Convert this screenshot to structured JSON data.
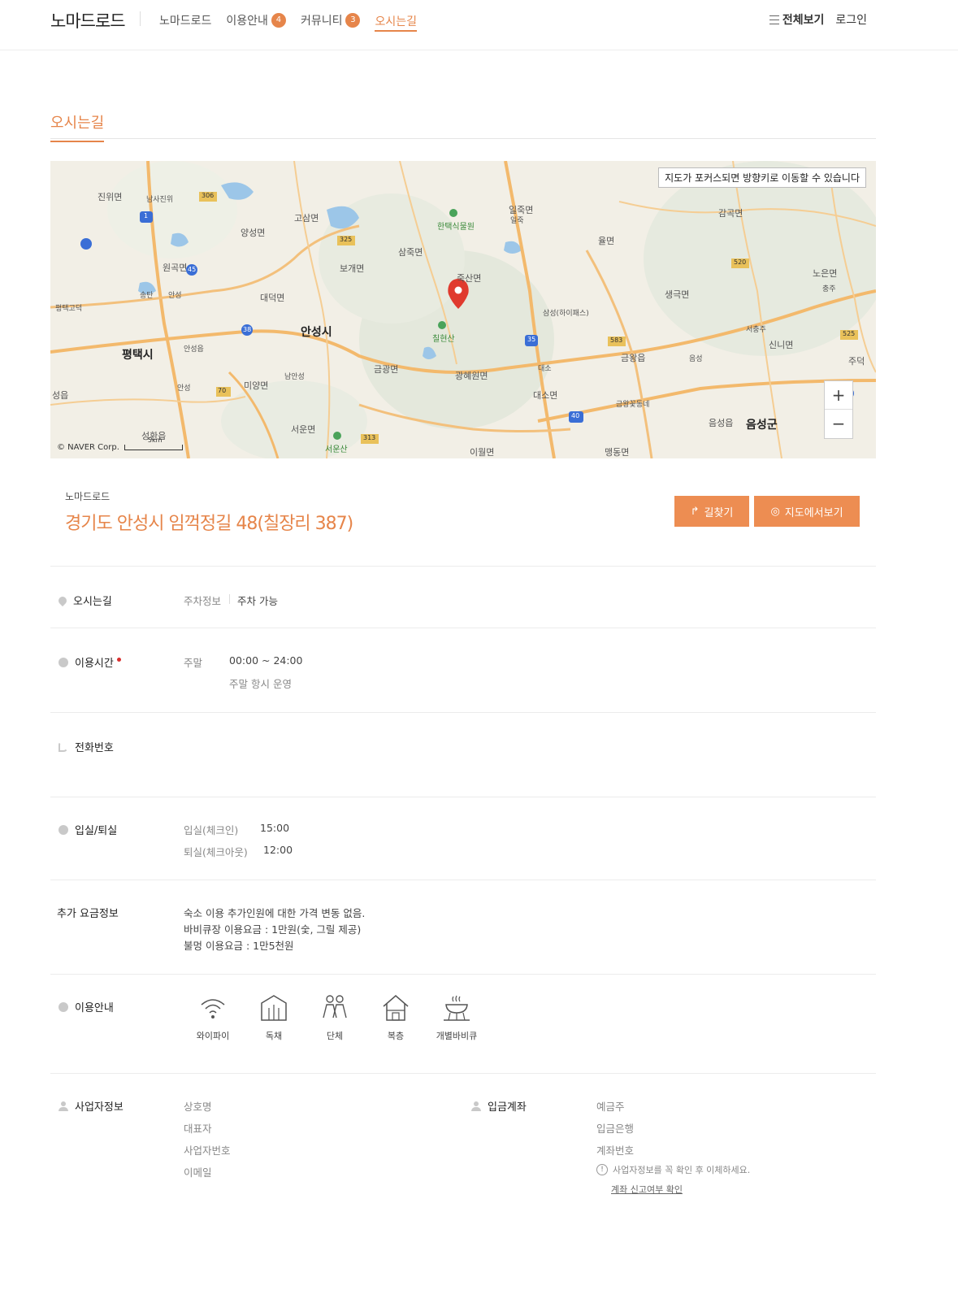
{
  "header": {
    "logo": "노마드로드",
    "nav": [
      {
        "label": "노마드로드",
        "badge": ""
      },
      {
        "label": "이용안내",
        "badge": "4"
      },
      {
        "label": "커뮤니티",
        "badge": "3"
      },
      {
        "label": "오시는길",
        "badge": ""
      }
    ],
    "all_menu": "전체보기",
    "login": "로그인"
  },
  "section_title": "오시는길",
  "map": {
    "tip": "지도가 포커스되면 방향키로 이동할 수 있습니다",
    "zoom_in": "+",
    "zoom_out": "−",
    "copyright": "© NAVER Corp.",
    "scale": "5km",
    "places": {
      "p1": "진위면",
      "p2": "남사진위",
      "p3": "고삼면",
      "p4": "양성면",
      "p5": "원곡면",
      "p6": "대덕면",
      "p7": "안성시",
      "p8": "평택시",
      "p9": "안성",
      "p10": "미양면",
      "p11": "서운면",
      "p12": "서운산",
      "p13": "성환읍",
      "p14": "보개면",
      "p15": "삼죽면",
      "p16": "죽산면",
      "p17": "칠현산",
      "p18": "금광면",
      "p19": "광혜원면",
      "p20": "이월면",
      "p21": "한택식물원",
      "p22": "일죽면",
      "p23": "율면",
      "p24": "생극면",
      "p25": "감곡면",
      "p26": "노은면",
      "p27": "신니면",
      "p28": "금왕읍",
      "p29": "대소면",
      "p30": "음성군",
      "p31": "음성읍",
      "p32": "맹동면",
      "p33": "일죽",
      "p34": "평택고덕",
      "p35": "송탄",
      "p36": "남안성",
      "p37": "일죽",
      "p38": "충주",
      "p39": "서충주",
      "p40": "음성",
      "p41": "대소",
      "p42": "금왕꽃동네",
      "p43": "삼성(하이패스)",
      "p44": "성읍",
      "p45": "주덕",
      "p46": "안성읍"
    },
    "routes": {
      "r1": "306",
      "r2": "325",
      "r3": "38",
      "r4": "70",
      "r5": "313",
      "r6": "583",
      "r7": "520",
      "r8": "525",
      "r9": "35",
      "r10": "40",
      "r11": "45",
      "r12": "1",
      "r13": "36"
    }
  },
  "address": {
    "sub": "노마드로드",
    "main": "경기도 안성시 임꺽정길 48(칠장리 387)",
    "route_button": "길찾기",
    "map_button": "지도에서보기"
  },
  "rows": {
    "directions": {
      "label": "오시는길",
      "key": "주차정보",
      "value": "주차 가능"
    },
    "hours": {
      "label": "이용시간",
      "key": "주말",
      "value": "00:00 ~ 24:00",
      "note": "주말 항시 운영"
    },
    "phone": {
      "label": "전화번호"
    },
    "checkinout": {
      "label": "입실/퇴실",
      "in_key": "입실(체크인)",
      "in_value": "15:00",
      "out_key": "퇴실(체크아웃)",
      "out_value": "12:00"
    },
    "extra_fee": {
      "label": "추가 요금정보",
      "lines": [
        "숙소 이용 추가인원에 대한 가격 변동 없음.",
        "바비큐장 이용요금 : 1만원(숯, 그릴 제공)",
        "불멍 이용요금 : 1만5천원"
      ]
    },
    "facilities": {
      "label": "이용안내",
      "items": [
        "와이파이",
        "독채",
        "단체",
        "복층",
        "개별바비큐"
      ]
    },
    "business": {
      "label": "사업자정보",
      "keys": [
        "상호명",
        "대표자",
        "사업자번호",
        "이메일"
      ]
    },
    "account": {
      "label": "입금계좌",
      "keys": [
        "예금주",
        "입금은행",
        "계좌번호"
      ],
      "note": "사업자정보를 꼭 확인 후 이체하세요.",
      "link": "계좌 신고여부 확인"
    }
  },
  "colors": {
    "accent": "#e6854a",
    "button": "#ed8d52",
    "marker": "#e03a2e"
  }
}
